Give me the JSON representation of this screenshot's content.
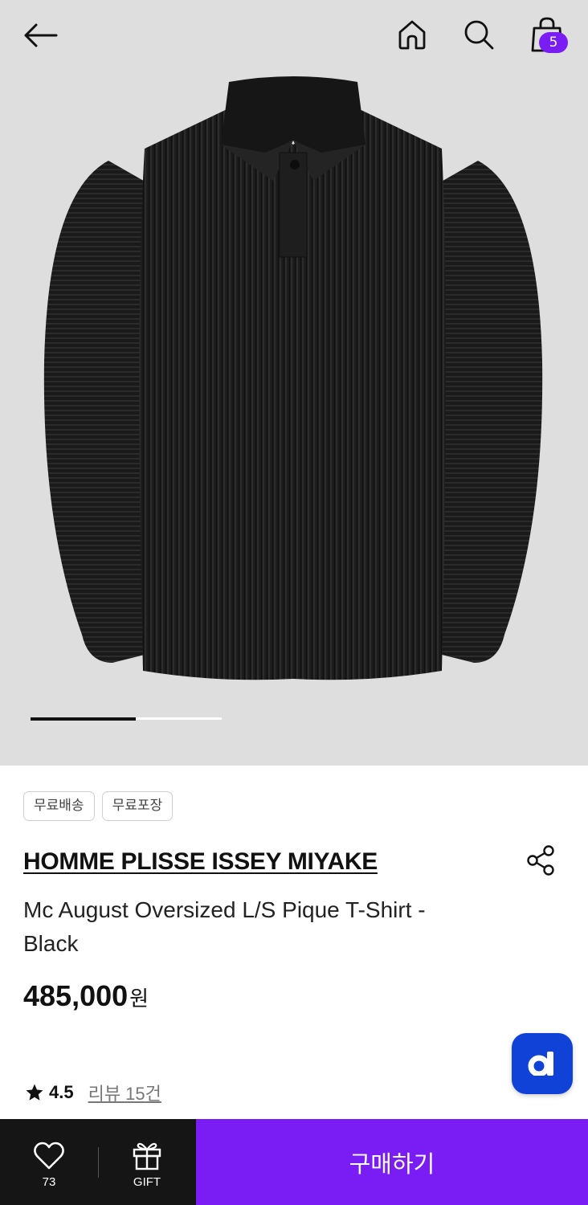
{
  "header": {
    "cart_count": "5",
    "icons": [
      "back-arrow-icon",
      "home-icon",
      "search-icon",
      "shopping-bag-icon"
    ]
  },
  "gallery": {
    "image_subject": "black pleated long-sleeve polo shirt",
    "pager_progress": 0.55
  },
  "tags": [
    "무료배송",
    "무료포장"
  ],
  "product": {
    "brand": "HOMME PLISSE ISSEY MIYAKE",
    "name": "Mc August Oversized L/S Pique T-Shirt - Black",
    "price": "485,000",
    "price_unit": "원"
  },
  "rating": {
    "value": "4.5",
    "reviews_label": "리뷰 15건"
  },
  "bottom_bar": {
    "like_count": "73",
    "gift_label": "GIFT",
    "buy_label": "구매하기"
  },
  "colors": {
    "accent": "#7a1cf4",
    "d_button": "#1042d8",
    "bottom_dark": "#151515",
    "hero_bg": "#dedede"
  }
}
